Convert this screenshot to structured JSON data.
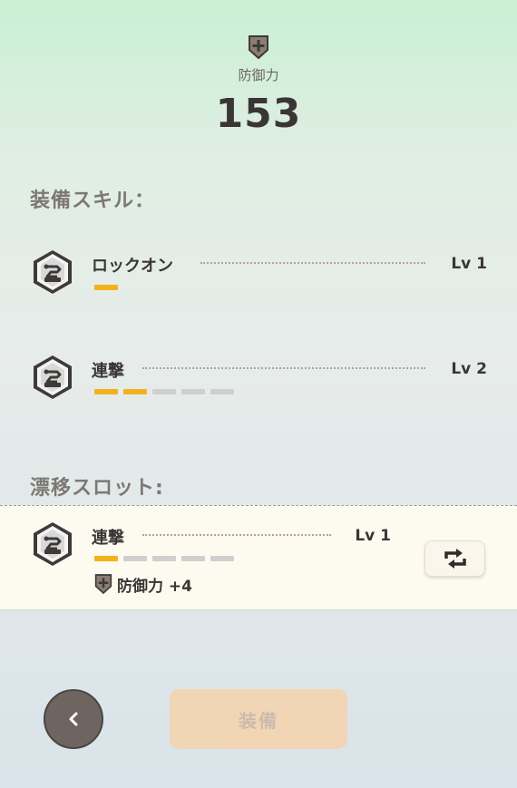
{
  "header": {
    "stat_icon": "defense-shield-icon",
    "stat_label": "防御力",
    "stat_value": "153"
  },
  "equipped_skills": {
    "title": "装備スキル：",
    "items": [
      {
        "name": "ロックオン",
        "level_text": "Lv 1",
        "level": 1,
        "max_level": 1,
        "icon": "robot-arm-badge-icon"
      },
      {
        "name": "連撃",
        "level_text": "Lv 2",
        "level": 2,
        "max_level": 5,
        "icon": "robot-arm-badge-icon"
      }
    ]
  },
  "drift_slot": {
    "title": "漂移スロット:",
    "item": {
      "name": "連撃",
      "level_text": "Lv 1",
      "level": 1,
      "max_level": 5,
      "icon": "robot-arm-badge-icon",
      "bonus_icon": "defense-shield-icon",
      "bonus_text": "防御力 +4"
    },
    "swap_icon": "swap-arrows-icon"
  },
  "footer": {
    "back_icon": "chevron-left-icon",
    "equip_label": "装備"
  },
  "colors": {
    "level_on": "#f2b21b",
    "level_off": "#cfcfcf",
    "equip_button": "#f5d3ad"
  }
}
